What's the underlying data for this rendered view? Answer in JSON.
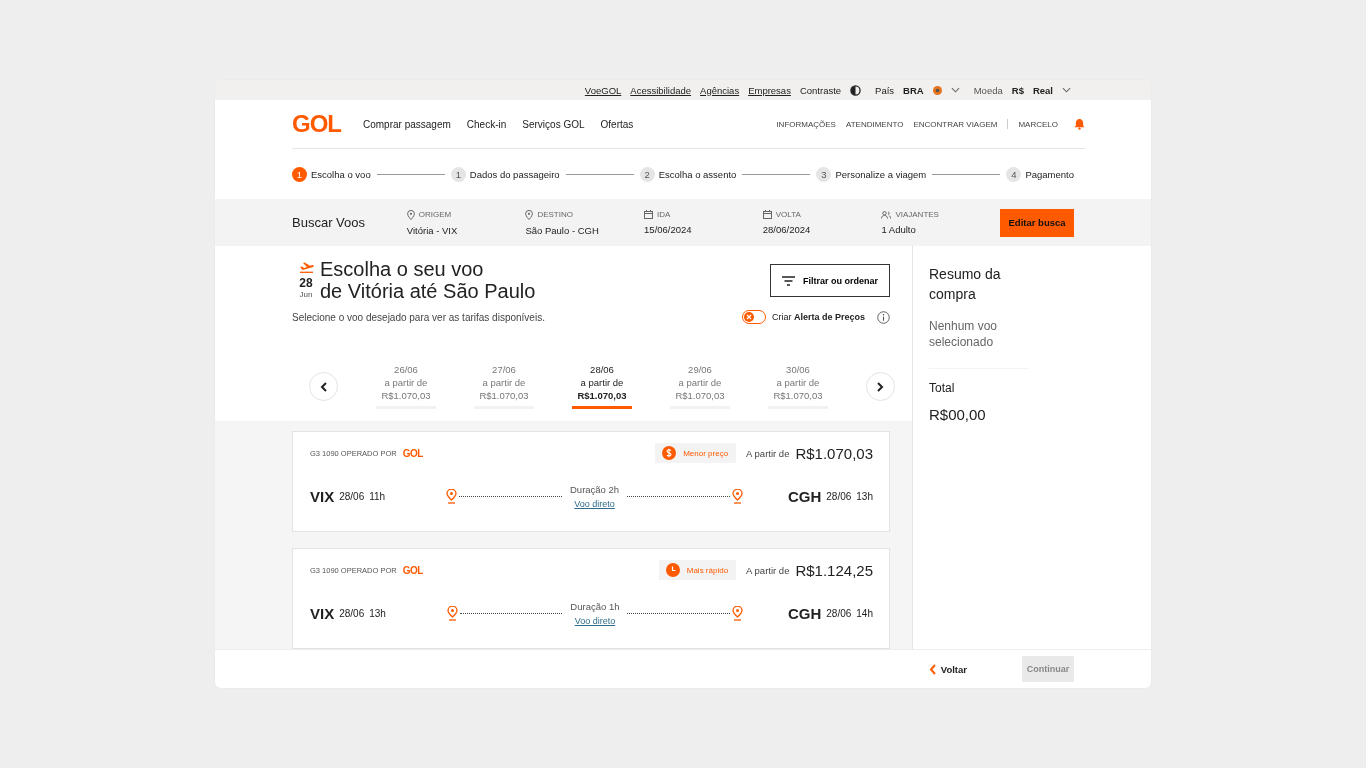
{
  "top_bar": {
    "links": [
      "VoeGOL",
      "Acessibilidade",
      "Agências",
      "Empresas"
    ],
    "contrast_label": "Contraste",
    "country_label": "País",
    "country": "BRA",
    "currency_label": "Moeda",
    "currency_symbol": "R$",
    "currency": "Real"
  },
  "header": {
    "logo": "GOL",
    "nav": [
      "Comprar passagem",
      "Check-in",
      "Serviços GOL",
      "Ofertas"
    ],
    "links": [
      "INFORMAÇÕES",
      "ATENDIMENTO",
      "ENCONTRAR VIAGEM"
    ],
    "user": "MARCELO"
  },
  "steps": [
    {
      "number": "1",
      "label": "Escolha o voo",
      "selected": true
    },
    {
      "number": "1",
      "label": "Dados do passageiro",
      "selected": false
    },
    {
      "number": "2",
      "label": "Escolha o assento",
      "selected": false
    },
    {
      "number": "3",
      "label": "Personalize a viagem",
      "selected": false
    },
    {
      "number": "4",
      "label": "Pagamento",
      "selected": false
    }
  ],
  "search": {
    "title": "Buscar Voos",
    "fields": [
      {
        "kind": "pin",
        "label": "ORIGEM",
        "value": "Vitória - VIX"
      },
      {
        "kind": "pin",
        "label": "DESTINO",
        "value": "São Paulo - CGH"
      },
      {
        "kind": "calendar",
        "label": "IDA",
        "value": "15/06/2024"
      },
      {
        "kind": "calendar",
        "label": "VOLTA",
        "value": "28/06/2024"
      },
      {
        "kind": "people",
        "label": "VIAJANTES",
        "value": "1 Adulto"
      }
    ],
    "button": "Editar busca"
  },
  "heading": {
    "day": "28",
    "month": "Jun",
    "title": "Escolha o seu voo",
    "subtitle": "de Vitória até São Paulo",
    "hint": "Selecione o voo desejado para ver as tarifas disponíveis.",
    "filter_button": "Filtrar ou ordenar",
    "alert": {
      "text": "Criar **Alerta de Preços**",
      "on": false
    }
  },
  "dates": [
    {
      "date": "26/06",
      "label": "a partir de",
      "price": "R$1.070,03",
      "selected": false
    },
    {
      "date": "27/06",
      "label": "a partir de",
      "price": "R$1.070,03",
      "selected": false
    },
    {
      "date": "28/06",
      "label": "a partir de",
      "price": "R$1.070,03",
      "selected": true
    },
    {
      "date": "29/06",
      "label": "a partir de",
      "price": "R$1.070,03",
      "selected": false
    },
    {
      "date": "30/06",
      "label": "a partir de",
      "price": "R$1.070,03",
      "selected": false
    }
  ],
  "flights": [
    {
      "operator": "G3 1090 OPERADO POR",
      "operator_logo": "GOL",
      "badge": {
        "kind": "price",
        "text": "Menor preço"
      },
      "price_label": "A partir de",
      "price": "R$1.070,03",
      "from": "VIX",
      "from_date": "28/06",
      "from_time": "11h",
      "duration": "Duração 2h",
      "direct": "Voo direto",
      "to": "CGH",
      "to_date": "28/06",
      "to_time": "13h"
    },
    {
      "operator": "G3 1090 OPERADO POR",
      "operator_logo": "GOL",
      "badge": {
        "kind": "fast",
        "text": "Mais rápido"
      },
      "price_label": "A partir de",
      "price": "R$1.124,25",
      "from": "VIX",
      "from_date": "28/06",
      "from_time": "13h",
      "duration": "Duração 1h",
      "direct": "Voo direto",
      "to": "CGH",
      "to_date": "28/06",
      "to_time": "14h"
    }
  ],
  "summary": {
    "title": "Resumo da compra",
    "empty": "Nenhum voo selecionado",
    "total_label": "Total",
    "total": "R$00,00"
  },
  "footer": {
    "back": "Voltar",
    "continue": "Continuar",
    "continue_disabled": true
  }
}
